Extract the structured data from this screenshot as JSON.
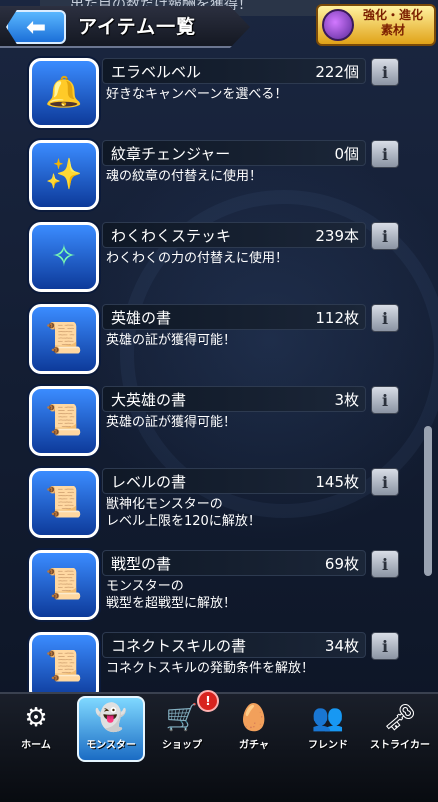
{
  "header": {
    "peek_text": "出た目の数だけ報酬を獲得！",
    "back_icon": "back-arrow-icon",
    "title": "アイテム一覧",
    "evolution_button": {
      "line1": "強化・進化",
      "line2": "素材"
    }
  },
  "items": [
    {
      "name": "エラベルベル",
      "count": "222個",
      "description": "好きなキャンペーンを選べる！",
      "icon": "bell-icon"
    },
    {
      "name": "紋章チェンジャー",
      "count": "0個",
      "description": "魂の紋章の付替えに使用！",
      "icon": "emblem-changer-icon"
    },
    {
      "name": "わくわくステッキ",
      "count": "239本",
      "description": "わくわくの力の付替えに使用！",
      "icon": "magic-stick-icon"
    },
    {
      "name": "英雄の書",
      "count": "112枚",
      "description": "英雄の証が獲得可能！",
      "icon": "scroll-icon"
    },
    {
      "name": "大英雄の書",
      "count": "3枚",
      "description": "英雄の証が獲得可能！",
      "icon": "scroll-icon"
    },
    {
      "name": "レベルの書",
      "count": "145枚",
      "description": "獣神化モンスターの\nレベル上限を120に解放！",
      "icon": "scroll-icon"
    },
    {
      "name": "戦型の書",
      "count": "69枚",
      "description": "モンスターの\n戦型を超戦型に解放！",
      "icon": "scroll-icon"
    },
    {
      "name": "コネクトスキルの書",
      "count": "34枚",
      "description": "コネクトスキルの発動条件を解放！",
      "icon": "scroll-icon"
    }
  ],
  "info_label": "i",
  "nav": {
    "items": [
      {
        "label": "ホーム",
        "icon": "home-icon"
      },
      {
        "label": "モンスター",
        "icon": "monster-icon",
        "active": true
      },
      {
        "label": "ショップ",
        "icon": "shop-cart-icon"
      },
      {
        "label": "ガチャ",
        "icon": "gacha-egg-icon"
      },
      {
        "label": "フレンド",
        "icon": "friends-icon"
      },
      {
        "label": "ストライカー",
        "icon": "striker-card-icon"
      }
    ],
    "badge": "!"
  },
  "colors": {
    "background": "#0d1626",
    "accent_blue": "#1c6fd8",
    "badge_red": "#d8231f"
  }
}
